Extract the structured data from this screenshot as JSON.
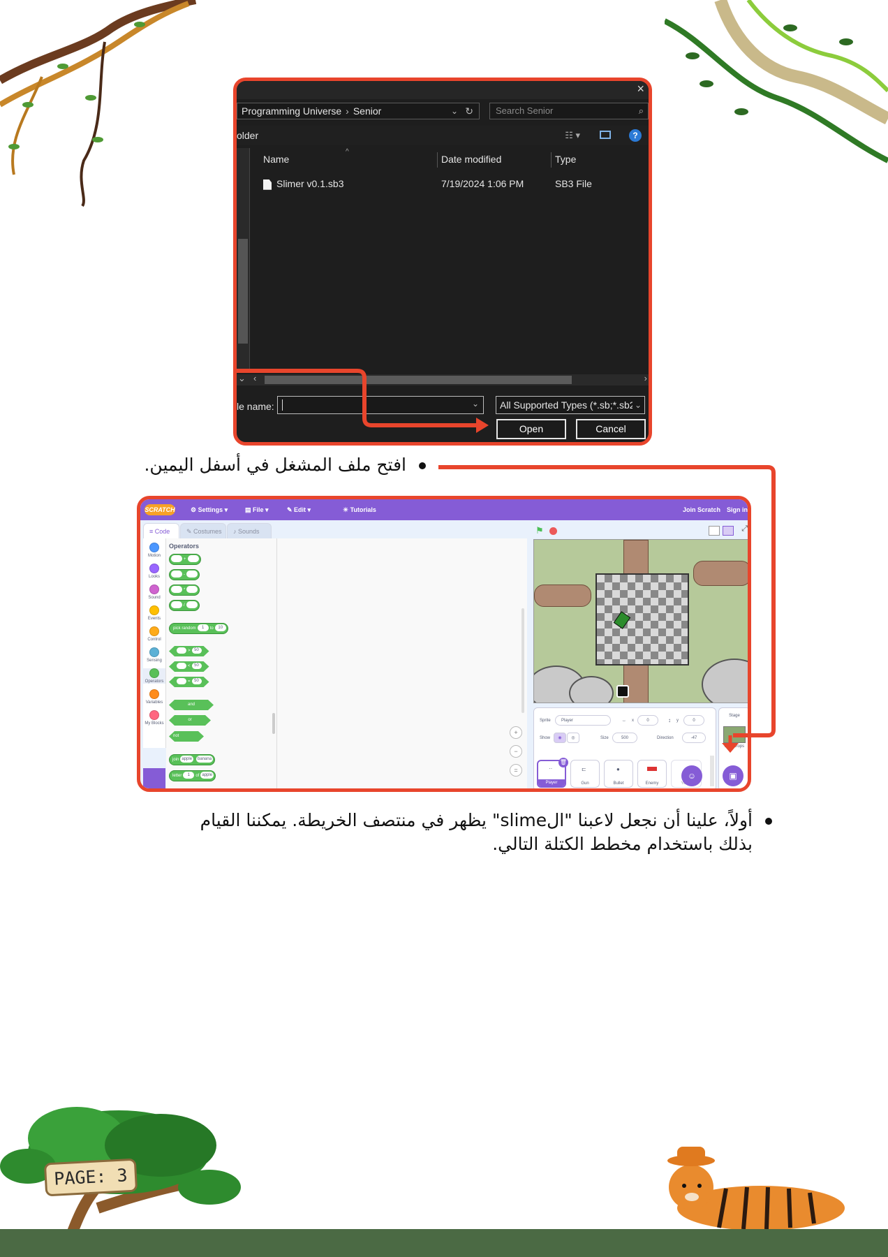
{
  "dialog": {
    "breadcrumb": [
      "Programming Universe",
      "Senior"
    ],
    "search_placeholder": "Search Senior",
    "toolbar_left": "older",
    "columns": {
      "name": "Name",
      "date": "Date modified",
      "type": "Type"
    },
    "files": [
      {
        "name": "Slimer v0.1.sb3",
        "date": "7/19/2024 1:06 PM",
        "type": "SB3 File"
      }
    ],
    "file_name_label": "le name:",
    "file_name_value": "",
    "filter": "All Supported Types (*.sb;*.sb2;",
    "open_label": "Open",
    "cancel_label": "Cancel"
  },
  "bullets": {
    "one": "افتح ملف المشغل في أسفل اليمين.",
    "two_line1": "أولاً، علينا أن نجعل لاعبنا \"الslime\" يظهر في منتصف الخريطة. يمكننا القيام",
    "two_line2": "بذلك باستخدام مخطط الكتلة التالي."
  },
  "scratch": {
    "logo": "SCRATCH",
    "menu": {
      "settings": "Settings",
      "file": "File",
      "edit": "Edit",
      "tutorials": "Tutorials",
      "join": "Join Scratch",
      "signin": "Sign in"
    },
    "tabs": {
      "code": "Code",
      "costumes": "Costumes",
      "sounds": "Sounds"
    },
    "categories": [
      "Motion",
      "Looks",
      "Sound",
      "Events",
      "Control",
      "Sensing",
      "Operators",
      "Variables",
      "My Blocks"
    ],
    "palette_title": "Operators",
    "blocks": {
      "ops": [
        "+",
        "-",
        "*",
        "/"
      ],
      "pick_random": "pick random",
      "pr_from": "1",
      "pr_to_word": "to",
      "pr_to": "10",
      "cmp": [
        ">",
        "<",
        "="
      ],
      "cmp_value": "50",
      "and": "and",
      "or": "or",
      "not": "not",
      "join": "join",
      "join_a": "apple",
      "join_b": "banana",
      "letter": "letter",
      "letter_n": "1",
      "letter_of": "of",
      "letter_s": "apple"
    },
    "sprite": {
      "sprite_label": "Sprite",
      "name": "Player",
      "x_label": "x",
      "x": "0",
      "y_label": "y",
      "y": "0",
      "show_label": "Show",
      "size_label": "Size",
      "size": "500",
      "direction_label": "Direction",
      "direction": "-47"
    },
    "sprites": [
      "Player",
      "Gun",
      "Bullet",
      "Enemy",
      "You..."
    ],
    "stage_panel": {
      "title": "Stage",
      "backdrops": "Backdrops"
    }
  },
  "page_label": "PAGE: 3",
  "colors": {
    "accent": "#e8452c",
    "scratch_purple": "#855cd6",
    "operators_green": "#59c059"
  }
}
